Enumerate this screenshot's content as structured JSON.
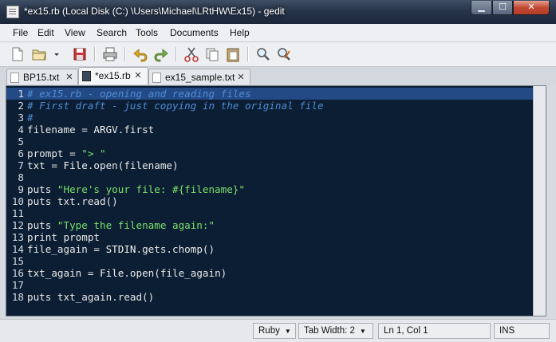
{
  "window": {
    "title": "*ex15.rb (Local Disk (C:) \\Users\\Michael\\LRtHW\\Ex15) - gedit",
    "min_label": "▁",
    "max_label": "☐",
    "close_label": "✕"
  },
  "menubar": {
    "items": [
      "File",
      "Edit",
      "View",
      "Search",
      "Tools",
      "Documents",
      "Help"
    ]
  },
  "toolbar": {
    "buttons": [
      "new-document",
      "open-document",
      "open-dropdown",
      "save",
      "print",
      "undo",
      "redo",
      "cut",
      "copy",
      "paste",
      "find",
      "find-replace"
    ]
  },
  "tabs": [
    {
      "label": "BP15.txt",
      "active": false
    },
    {
      "label": "*ex15.rb",
      "active": true
    },
    {
      "label": "ex15_sample.txt",
      "active": false
    }
  ],
  "editor": {
    "lines": [
      {
        "n": "1",
        "segments": [
          {
            "t": "# ex15.rb - opening and reading files",
            "c": "comment"
          }
        ],
        "current": true
      },
      {
        "n": "2",
        "segments": [
          {
            "t": "# First draft - just copying in the original file",
            "c": "comment"
          }
        ]
      },
      {
        "n": "3",
        "segments": [
          {
            "t": "#",
            "c": "comment"
          }
        ]
      },
      {
        "n": "4",
        "segments": [
          {
            "t": "filename = ",
            "c": "plain"
          },
          {
            "t": "ARGV",
            "c": "const"
          },
          {
            "t": ".first",
            "c": "plain"
          }
        ]
      },
      {
        "n": "5",
        "segments": []
      },
      {
        "n": "6",
        "segments": [
          {
            "t": "prompt = ",
            "c": "plain"
          },
          {
            "t": "\"> \"",
            "c": "str"
          }
        ]
      },
      {
        "n": "7",
        "segments": [
          {
            "t": "txt = ",
            "c": "plain"
          },
          {
            "t": "File",
            "c": "const"
          },
          {
            "t": ".open(filename)",
            "c": "plain"
          }
        ]
      },
      {
        "n": "8",
        "segments": []
      },
      {
        "n": "9",
        "segments": [
          {
            "t": "puts ",
            "c": "plain"
          },
          {
            "t": "\"Here's your file: #{filename}\"",
            "c": "str"
          }
        ]
      },
      {
        "n": "10",
        "segments": [
          {
            "t": "puts txt.read()",
            "c": "plain"
          }
        ]
      },
      {
        "n": "11",
        "segments": []
      },
      {
        "n": "12",
        "segments": [
          {
            "t": "puts ",
            "c": "plain"
          },
          {
            "t": "\"Type the filename again:\"",
            "c": "str"
          }
        ]
      },
      {
        "n": "13",
        "segments": [
          {
            "t": "print prompt",
            "c": "plain"
          }
        ]
      },
      {
        "n": "14",
        "segments": [
          {
            "t": "file_again = ",
            "c": "plain"
          },
          {
            "t": "STDIN",
            "c": "const"
          },
          {
            "t": ".gets.chomp()",
            "c": "plain"
          }
        ]
      },
      {
        "n": "15",
        "segments": []
      },
      {
        "n": "16",
        "segments": [
          {
            "t": "txt_again = ",
            "c": "plain"
          },
          {
            "t": "File",
            "c": "const"
          },
          {
            "t": ".open(file_again)",
            "c": "plain"
          }
        ]
      },
      {
        "n": "17",
        "segments": []
      },
      {
        "n": "18",
        "segments": [
          {
            "t": "puts txt_again.read()",
            "c": "plain"
          }
        ]
      }
    ]
  },
  "statusbar": {
    "language": "Ruby",
    "tab_width": "Tab Width: 2",
    "position": "Ln 1, Col 1",
    "mode": "INS"
  },
  "colors": {
    "editor_bg": "#0b1e33",
    "current_line": "#244a85",
    "comment": "#4f8cd6",
    "string": "#7ee06a"
  }
}
